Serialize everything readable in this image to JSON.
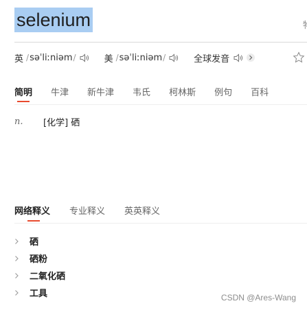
{
  "header": {
    "word": "selenium",
    "corner_char": "物"
  },
  "pronunciation": {
    "uk": {
      "region": "英",
      "ipa": "səˈliːniəm",
      "icon": "speaker-icon"
    },
    "us": {
      "region": "美",
      "ipa": "səˈliːniəm",
      "icon": "speaker-icon"
    },
    "global": {
      "label": "全球发音",
      "icon": "speaker-icon"
    },
    "more_icon": "chevron-right-icon",
    "favorite_icon": "star-icon"
  },
  "dict_tabs": [
    "简明",
    "牛津",
    "新牛津",
    "韦氏",
    "柯林斯",
    "例句",
    "百科"
  ],
  "definition": {
    "pos": "n.",
    "text": "[化学] 硒"
  },
  "network": {
    "tabs": [
      "网络释义",
      "专业释义",
      "英英释义"
    ],
    "items": [
      "硒",
      "硒粉",
      "二氧化硒",
      "工具"
    ]
  },
  "watermark": "CSDN @Ares-Wang",
  "colors": {
    "selection": "#a9cdf2",
    "accent": "#e84a2e"
  }
}
